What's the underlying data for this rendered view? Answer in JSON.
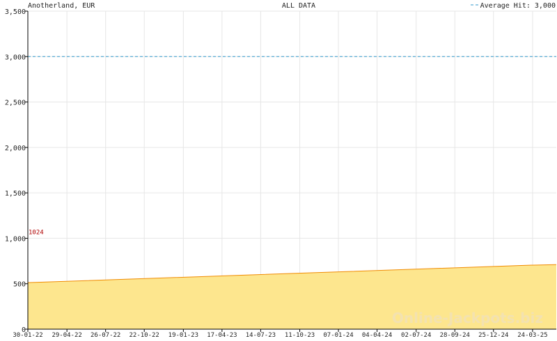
{
  "chart_data": {
    "type": "area",
    "title": "ALL DATA",
    "game_currency": "Anotherland, EUR",
    "legend": {
      "label": "Average Hit: 3,000",
      "placement": "top-right"
    },
    "average_hit": 3000,
    "ylim": [
      0,
      3500
    ],
    "y_ticks": [
      "0",
      "500",
      "1,000",
      "1,500",
      "2,000",
      "2,500",
      "3,000",
      "3,500"
    ],
    "y_tick_values": [
      0,
      500,
      1000,
      1500,
      2000,
      2500,
      3000,
      3500
    ],
    "x_ticks": [
      "30-01-22",
      "29-04-22",
      "26-07-22",
      "22-10-22",
      "19-01-23",
      "17-04-23",
      "14-07-23",
      "11-10-23",
      "07-01-24",
      "04-04-24",
      "02-07-24",
      "28-09-24",
      "25-12-24",
      "24-03-25"
    ],
    "series": [
      {
        "points": [
          {
            "x": "30-01-22",
            "y": 1024
          },
          {
            "x": "30-01-22",
            "y": 512
          },
          {
            "x": "24-03-25",
            "y": 705
          },
          {
            "x": "17-05-25",
            "y": 710
          }
        ],
        "color": "#f08a00",
        "fill": "#fde68e"
      }
    ],
    "annotations": [
      {
        "x": "30-01-22",
        "y": 1024,
        "text": "1024",
        "color": "#b00000"
      }
    ],
    "grid": true,
    "watermark": "Online-Jackpots.biz",
    "colors": {
      "grid": "#e6e6e6",
      "average_line": "#3399cc",
      "axis": "#000000"
    }
  }
}
